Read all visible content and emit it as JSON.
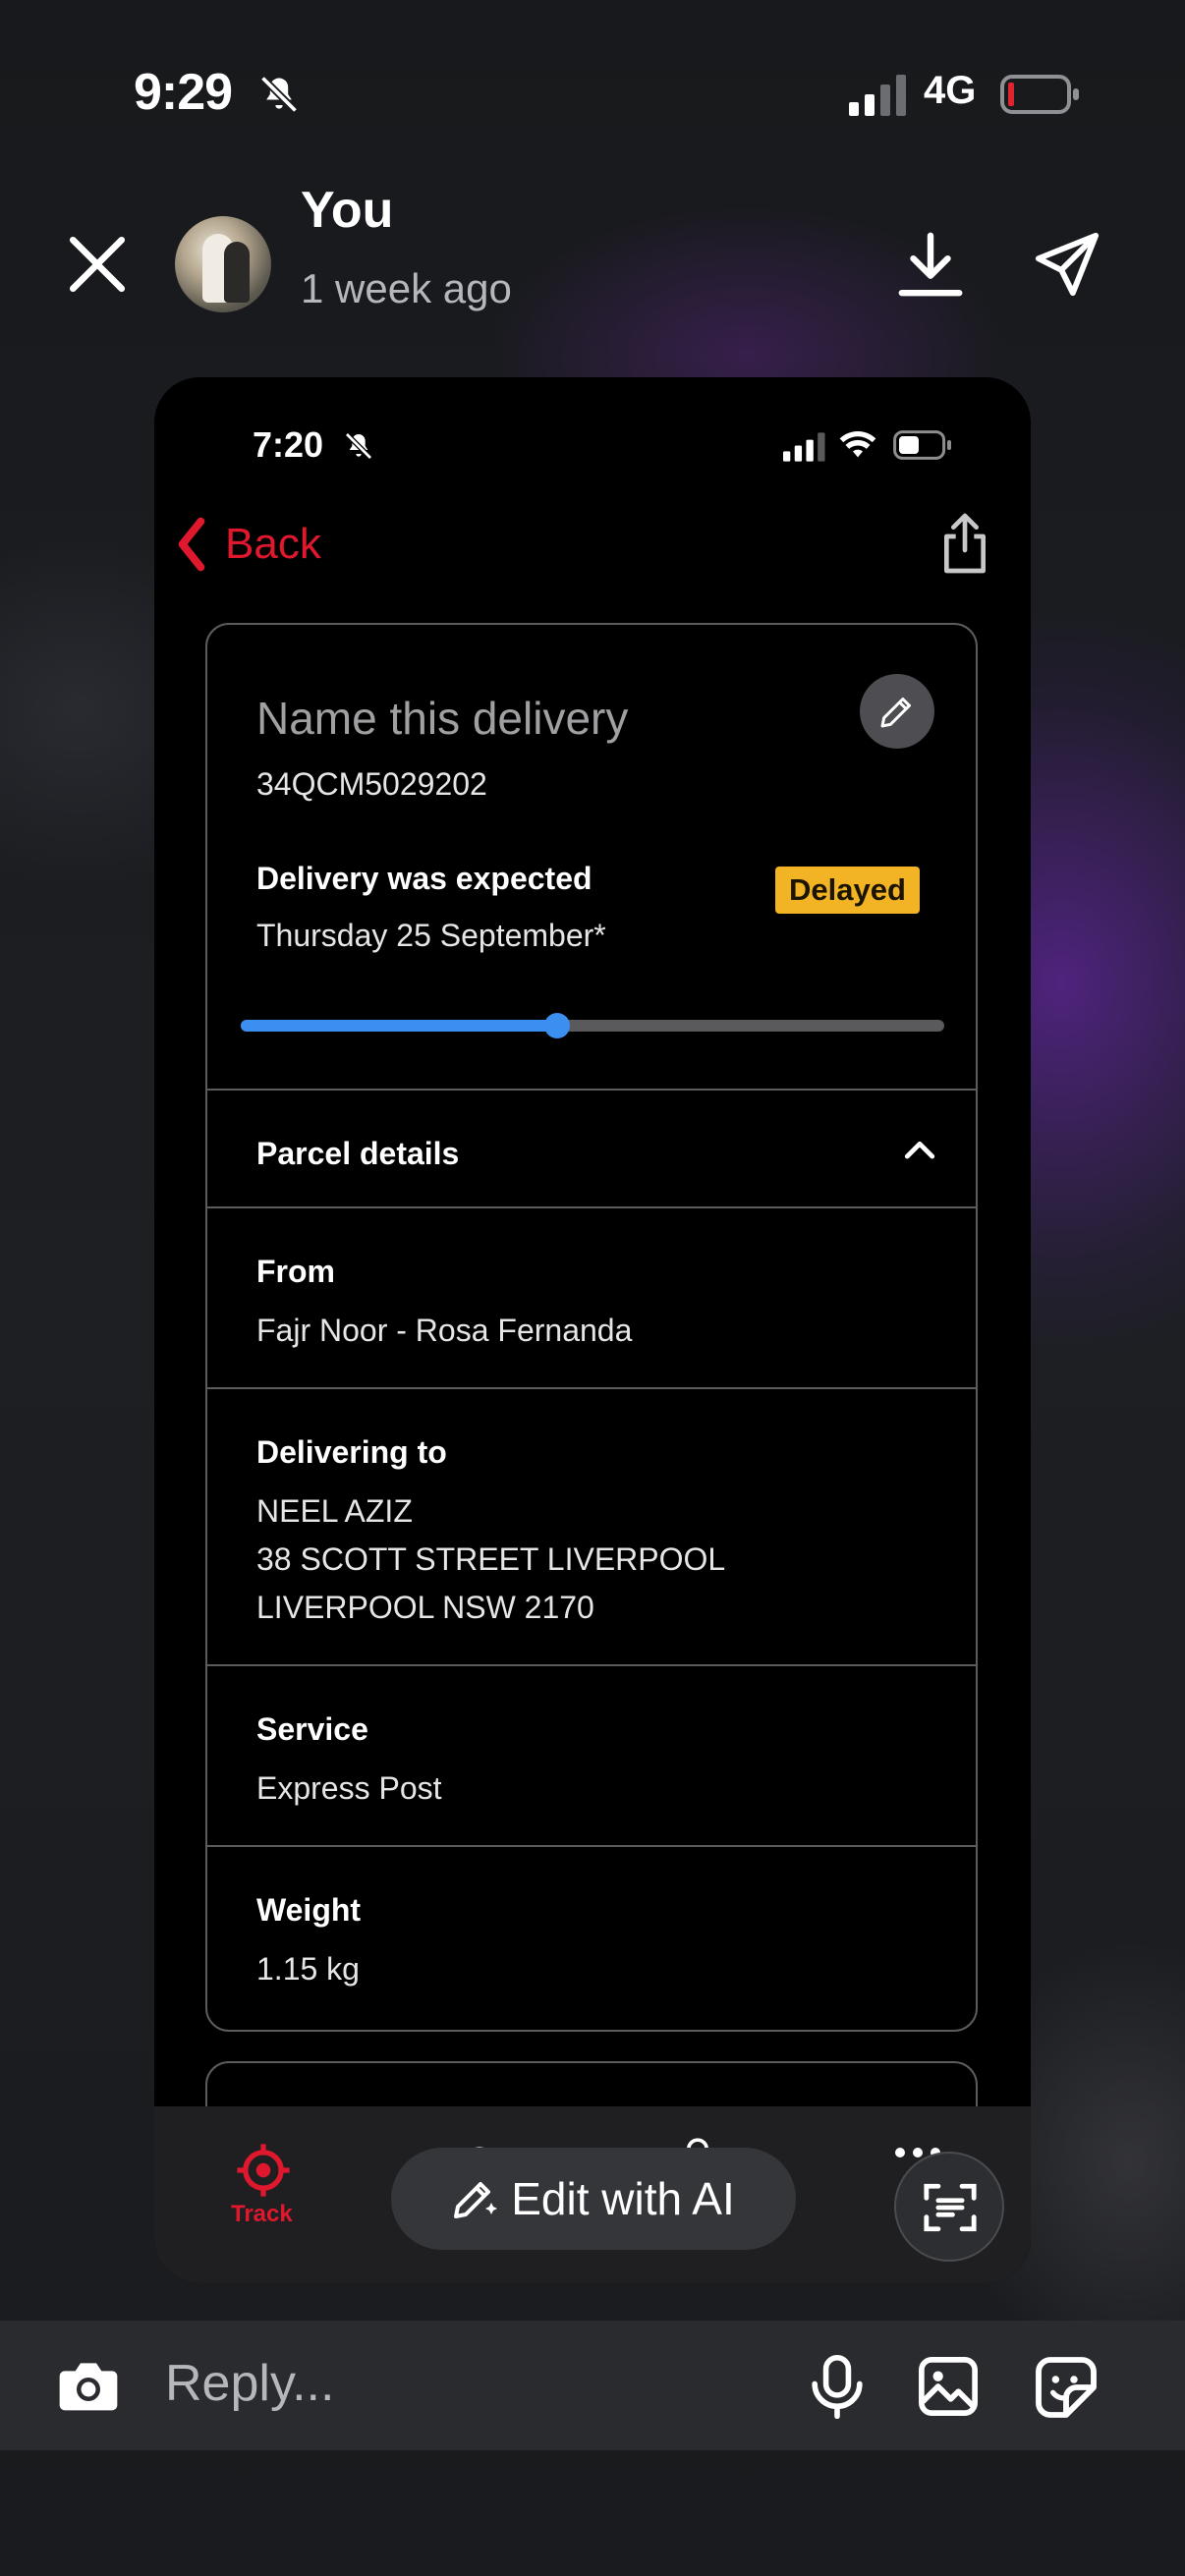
{
  "status_bar": {
    "time": "9:29",
    "network": "4G"
  },
  "story": {
    "user": "You",
    "posted": "1 week ago"
  },
  "inner": {
    "status_time": "7:20",
    "back_label": "Back",
    "delivery": {
      "title_placeholder": "Name this delivery",
      "tracking_number": "34QCM5029202",
      "expected_label": "Delivery was expected",
      "expected_date": "Thursday 25 September*",
      "status_badge": "Delayed",
      "progress_fraction": 0.45
    },
    "parcel_details": {
      "heading": "Parcel details",
      "from_label": "From",
      "from_value": "Fajr Noor - Rosa Fernanda",
      "to_label": "Delivering to",
      "to_lines": [
        "NEEL AZIZ",
        "38 SCOTT STREET LIVERPOOL",
        "LIVERPOOL NSW 2170"
      ],
      "service_label": "Service",
      "service_value": "Express Post",
      "weight_label": "Weight",
      "weight_value": "1.15 kg"
    },
    "tabbar": {
      "track_label": "Track"
    }
  },
  "overlay": {
    "edit_ai_label": "Edit with AI"
  },
  "reply": {
    "placeholder": "Reply..."
  },
  "colors": {
    "accent_red": "#e0182d",
    "progress_blue": "#3a8ff0",
    "badge_yellow": "#f2b324"
  },
  "icons": [
    "bell-slash-icon",
    "close-icon",
    "download-icon",
    "send-icon",
    "chevron-left-icon",
    "share-icon",
    "pencil-icon",
    "chevron-up-icon",
    "crosshair-icon",
    "scan-text-icon",
    "camera-icon",
    "microphone-icon",
    "image-icon",
    "sticker-icon"
  ]
}
